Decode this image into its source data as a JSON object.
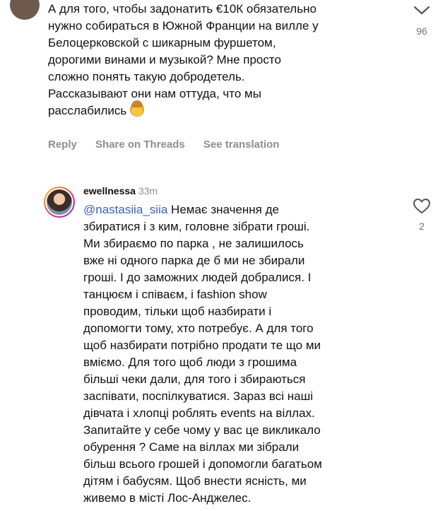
{
  "comment_top": {
    "text": "А для того, чтобы задонатить €10К обязательно\nнужно собираться в Южной Франции на вилле у\nБелоцерковской с шикарным фуршетом,\nдорогими винами и музыкой? Мне просто\nсложно понять такую добродетель.\nРассказывают они нам оттуда, что мы\nрасслабились",
    "emoji": "woman-facepalming-emoji",
    "likes": "96",
    "actions": {
      "reply": "Reply",
      "share": "Share on Threads",
      "translate": "See translation"
    }
  },
  "reply": {
    "username": "ewellnessa",
    "time": "33m",
    "mention": "@nastasiia_siia",
    "text": " Немає значення де\nзбиратися і з ким, головне зібрати гроші.\nМи збираємо по парка , не залишилось\nвже ні одного парка де б ми не збирали\nгроші. І до заможних людей добралися. І\nтанцюєм  і співаєм, і fashion show\nпроводим, тільки щоб назбирати і\nдопомогти тому, хто потребує. А для того\nщоб назбирати потрібно продати те що ми\nвміємо. Для того щоб люди з грошима\nбільші чеки дали, для того і збираються\nзаспівати, поспілкуватися. Зараз всі наші\nдівчата і хлопці роблять events на віллах.\nЗапитайте у себе  чому у вас це викликало\nобурення ?  Саме на віллах ми зібрали\nбільш всього грошей і допомогли багатьом\nдітям і бабусям. Щоб внести ясність, ми\nживемо в місті Лос-Анджелес.",
    "likes": "2"
  }
}
